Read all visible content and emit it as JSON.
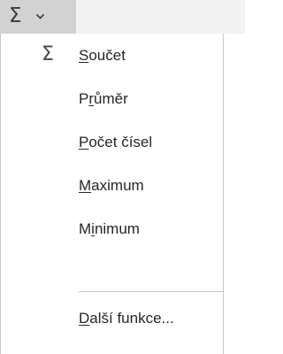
{
  "toolbar": {
    "sum_icon": "sigma-icon",
    "sum_glyph": "Σ",
    "dropdown_icon": "chevron-down-icon"
  },
  "menu": {
    "items": [
      {
        "pre": "",
        "key": "S",
        "post": "oučet",
        "icon": "sigma-icon",
        "glyph": "Σ"
      },
      {
        "pre": "P",
        "key": "r",
        "post": "ůměr",
        "icon": "",
        "glyph": ""
      },
      {
        "pre": "",
        "key": "P",
        "post": "očet čísel",
        "icon": "",
        "glyph": ""
      },
      {
        "pre": "",
        "key": "M",
        "post": "aximum",
        "icon": "",
        "glyph": ""
      },
      {
        "pre": "M",
        "key": "i",
        "post": "nimum",
        "icon": "",
        "glyph": ""
      },
      {
        "pre": "",
        "key": "D",
        "post": "alší funkce...",
        "icon": "",
        "glyph": ""
      }
    ]
  }
}
